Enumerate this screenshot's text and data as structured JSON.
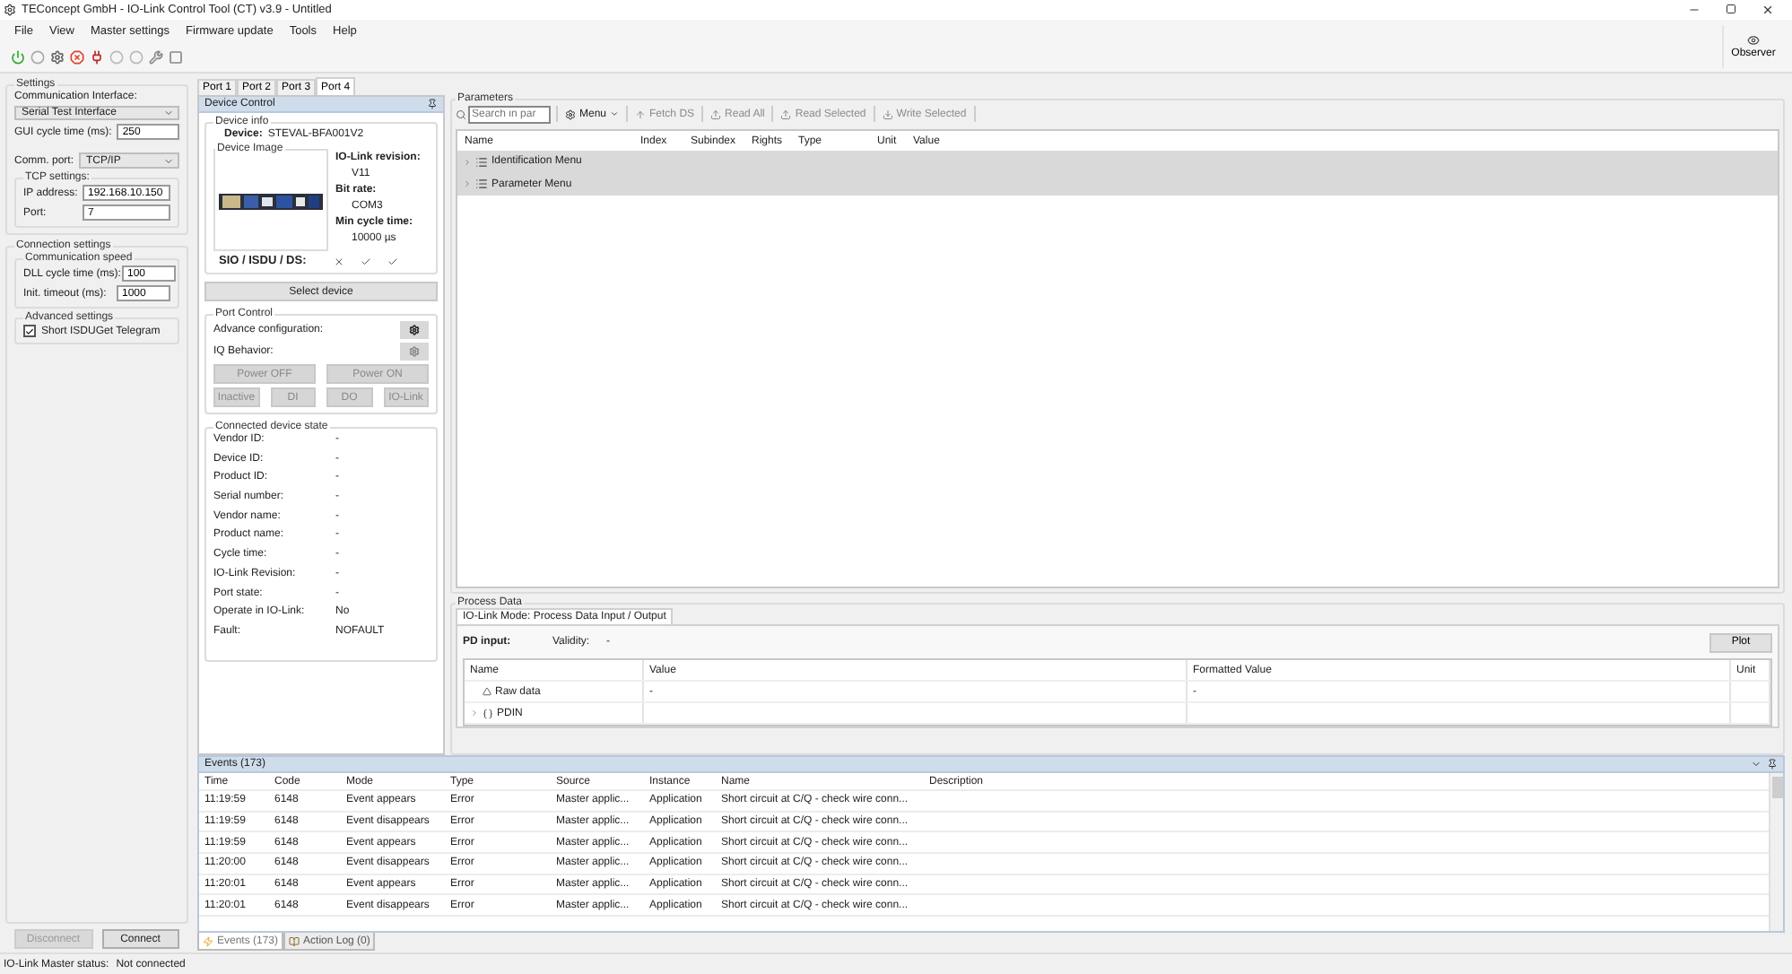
{
  "window": {
    "title": "TEConcept GmbH - IO-Link Control Tool (CT) v3.9 - Untitled"
  },
  "menu": [
    "File",
    "View",
    "Master settings",
    "Firmware update",
    "Tools",
    "Help"
  ],
  "observer": {
    "label": "Observer"
  },
  "settings": {
    "title": "Settings",
    "interface_label": "Communication Interface:",
    "interface": "Serial Test Interface",
    "gui_cycle_label": "GUI cycle time (ms):",
    "gui_cycle": "250",
    "comm_port_label": "Comm. port:",
    "comm_port": "TCP/IP",
    "tcp_title": "TCP settings:",
    "ip_label": "IP address:",
    "ip": "192.168.10.150",
    "port_label": "Port:",
    "port": "7"
  },
  "connection": {
    "title": "Connection settings",
    "speed_title": "Communication speed",
    "dll_label": "DLL cycle time (ms):",
    "dll": "100",
    "timeout_label": "Init. timeout (ms):",
    "timeout": "1000",
    "advanced_title": "Advanced settings",
    "short_isdu": {
      "label": "Short ISDUGet Telegram",
      "checked": true
    }
  },
  "connect_buttons": [
    {
      "label": "Disconnect",
      "disabled": true
    },
    {
      "label": "Connect",
      "disabled": false
    }
  ],
  "status": {
    "label": "IO-Link Master status:",
    "value": "Not connected"
  },
  "port_tabs": [
    {
      "label": "Port 1",
      "selected": false
    },
    {
      "label": "Port 2",
      "selected": false
    },
    {
      "label": "Port 3",
      "selected": false
    },
    {
      "label": "Port 4",
      "selected": true
    }
  ],
  "device_control": {
    "title": "Device Control",
    "info_title": "Device info",
    "device_label": "Device:",
    "device": "STEVAL-BFA001V2",
    "image_title": "Device Image",
    "revision_label": "IO-Link revision:",
    "revision": "V11",
    "bitrate_label": "Bit rate:",
    "bitrate": "COM3",
    "min_cycle_label": "Min cycle time:",
    "min_cycle": "10000 µs",
    "sio_label": "SIO / ISDU / DS:",
    "sio_flags": [
      {
        "supported": false
      },
      {
        "supported": true
      },
      {
        "supported": true
      }
    ],
    "select_button": "Select device"
  },
  "port_control": {
    "title": "Port Control",
    "rows": [
      {
        "label": "Advance configuration:",
        "disabled": false
      },
      {
        "label": "IQ Behavior:",
        "disabled": true
      }
    ],
    "power_buttons": [
      {
        "label": "Power OFF",
        "disabled": true
      },
      {
        "label": "Power ON",
        "disabled": true
      }
    ],
    "mode_buttons": [
      {
        "label": "Inactive",
        "disabled": true
      },
      {
        "label": "DI",
        "disabled": true
      },
      {
        "label": "DO",
        "disabled": true
      },
      {
        "label": "IO-Link",
        "disabled": true
      }
    ]
  },
  "device_state": {
    "title": "Connected device state",
    "rows": [
      {
        "label": "Vendor ID:",
        "value": "-"
      },
      {
        "label": "Device ID:",
        "value": "-"
      },
      {
        "label": "Product ID:",
        "value": "-"
      },
      {
        "label": "Serial number:",
        "value": "-"
      },
      {
        "label": "Vendor name:",
        "value": "-"
      },
      {
        "label": "Product name:",
        "value": "-"
      },
      {
        "label": "Cycle time:",
        "value": "-"
      },
      {
        "label": "IO-Link Revision:",
        "value": "-"
      },
      {
        "label": "Port state:",
        "value": "-"
      },
      {
        "label": "Operate in IO-Link:",
        "value": "No"
      },
      {
        "label": "Fault:",
        "value": "NOFAULT"
      }
    ]
  },
  "parameters": {
    "title": "Parameters",
    "search_placeholder": "Search in par",
    "toolbar": [
      {
        "kind": "menu",
        "label": "Menu",
        "disabled": false
      },
      {
        "kind": "fetch",
        "label": "Fetch DS",
        "disabled": true
      },
      {
        "kind": "read",
        "label": "Read All",
        "disabled": true
      },
      {
        "kind": "read",
        "label": "Read Selected",
        "disabled": true
      },
      {
        "kind": "write",
        "label": "Write Selected",
        "disabled": true
      }
    ],
    "columns": [
      "Name",
      "Index",
      "Subindex",
      "Rights",
      "Type",
      "Unit",
      "Value"
    ],
    "rows": [
      {
        "name": "Identification Menu",
        "selected": true
      },
      {
        "name": "Parameter Menu",
        "selected": true
      }
    ]
  },
  "process_data": {
    "title": "Process Data",
    "tab": "IO-Link Mode: Process Data Input / Output",
    "pd_input_label": "PD input:",
    "validity_label": "Validity:",
    "validity": "-",
    "plot_button": "Plot",
    "columns": [
      "Name",
      "Value",
      "Formatted Value",
      "Unit"
    ],
    "rows": [
      {
        "kind": "raw",
        "name": "Raw data",
        "value": "-",
        "formatted": "-"
      },
      {
        "kind": "node",
        "name": "PDIN"
      }
    ]
  },
  "events": {
    "title": "Events (173)",
    "columns": [
      "Time",
      "Code",
      "Mode",
      "Type",
      "Source",
      "Instance",
      "Name",
      "Description"
    ],
    "rows": [
      [
        "11:19:59",
        "6148",
        "Event appears",
        "Error",
        "Master applic...",
        "Application",
        "Short circuit at C/Q - check wire conn..."
      ],
      [
        "11:19:59",
        "6148",
        "Event disappears",
        "Error",
        "Master applic...",
        "Application",
        "Short circuit at C/Q - check wire conn..."
      ],
      [
        "11:19:59",
        "6148",
        "Event appears",
        "Error",
        "Master applic...",
        "Application",
        "Short circuit at C/Q - check wire conn..."
      ],
      [
        "11:20:00",
        "6148",
        "Event disappears",
        "Error",
        "Master applic...",
        "Application",
        "Short circuit at C/Q - check wire conn..."
      ],
      [
        "11:20:01",
        "6148",
        "Event appears",
        "Error",
        "Master applic...",
        "Application",
        "Short circuit at C/Q - check wire conn..."
      ],
      [
        "11:20:01",
        "6148",
        "Event disappears",
        "Error",
        "Master applic...",
        "Application",
        "Short circuit at C/Q - check wire conn..."
      ]
    ]
  },
  "bottom_tabs": [
    {
      "kind": "events",
      "label": "Events (173)",
      "selected": true
    },
    {
      "kind": "log",
      "label": "Action Log (0)",
      "selected": false
    }
  ]
}
